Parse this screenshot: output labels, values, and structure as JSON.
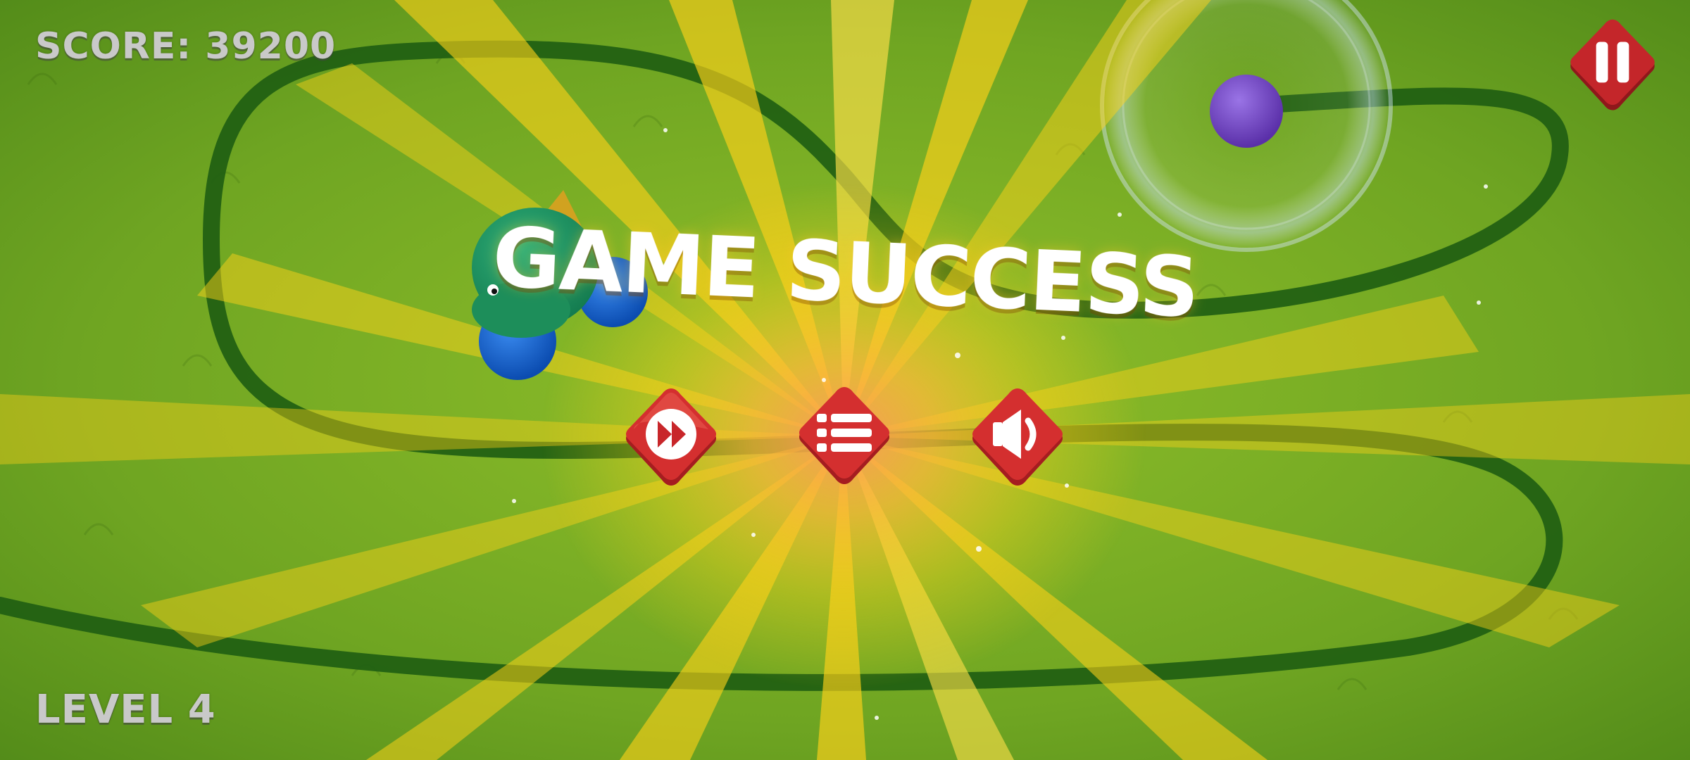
{
  "hud": {
    "score_text": "SCORE: 39200",
    "level_text": "LEVEL 4"
  },
  "overlay": {
    "title": "GAME SUCCESS",
    "buttons": [
      {
        "id": "next",
        "icon": "fast-forward-icon"
      },
      {
        "id": "menu",
        "icon": "level-list-icon"
      },
      {
        "id": "sound",
        "icon": "speaker-sound-icon"
      }
    ]
  },
  "controls": {
    "pause_icon": "pause-icon"
  },
  "colors": {
    "grass": "#5f9a1c",
    "track": "#1f5e12",
    "button_red": "#c8262a",
    "burst_yellow": "#ffd21a",
    "hud_text": "#c9c9c9"
  }
}
